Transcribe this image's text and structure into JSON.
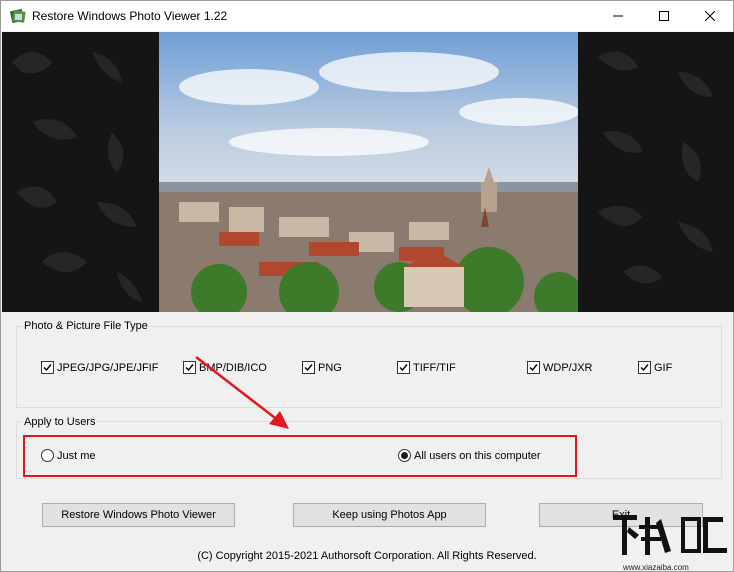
{
  "window": {
    "title": "Restore Windows Photo Viewer 1.22"
  },
  "file_types": {
    "group_label": "Photo & Picture File Type",
    "items": [
      {
        "label": "JPEG/JPG/JPE/JFIF",
        "checked": true
      },
      {
        "label": "BMP/DIB/ICO",
        "checked": true
      },
      {
        "label": "PNG",
        "checked": true
      },
      {
        "label": "TIFF/TIF",
        "checked": true
      },
      {
        "label": "WDP/JXR",
        "checked": true
      },
      {
        "label": "GIF",
        "checked": true
      }
    ]
  },
  "users": {
    "group_label": "Apply to Users",
    "options": [
      {
        "label": "Just me",
        "selected": false
      },
      {
        "label": "All users on this computer",
        "selected": true
      }
    ]
  },
  "buttons": {
    "restore": "Restore Windows Photo Viewer",
    "keep": "Keep using Photos App",
    "exit": "Exit"
  },
  "footer": {
    "copyright": "(C) Copyright 2015-2021 Authorsoft Corporation. All Rights Reserved."
  },
  "watermark": {
    "site": "www.xiazaiba.com"
  },
  "colors": {
    "highlight": "#e0191e",
    "arrow": "#e0191e"
  }
}
